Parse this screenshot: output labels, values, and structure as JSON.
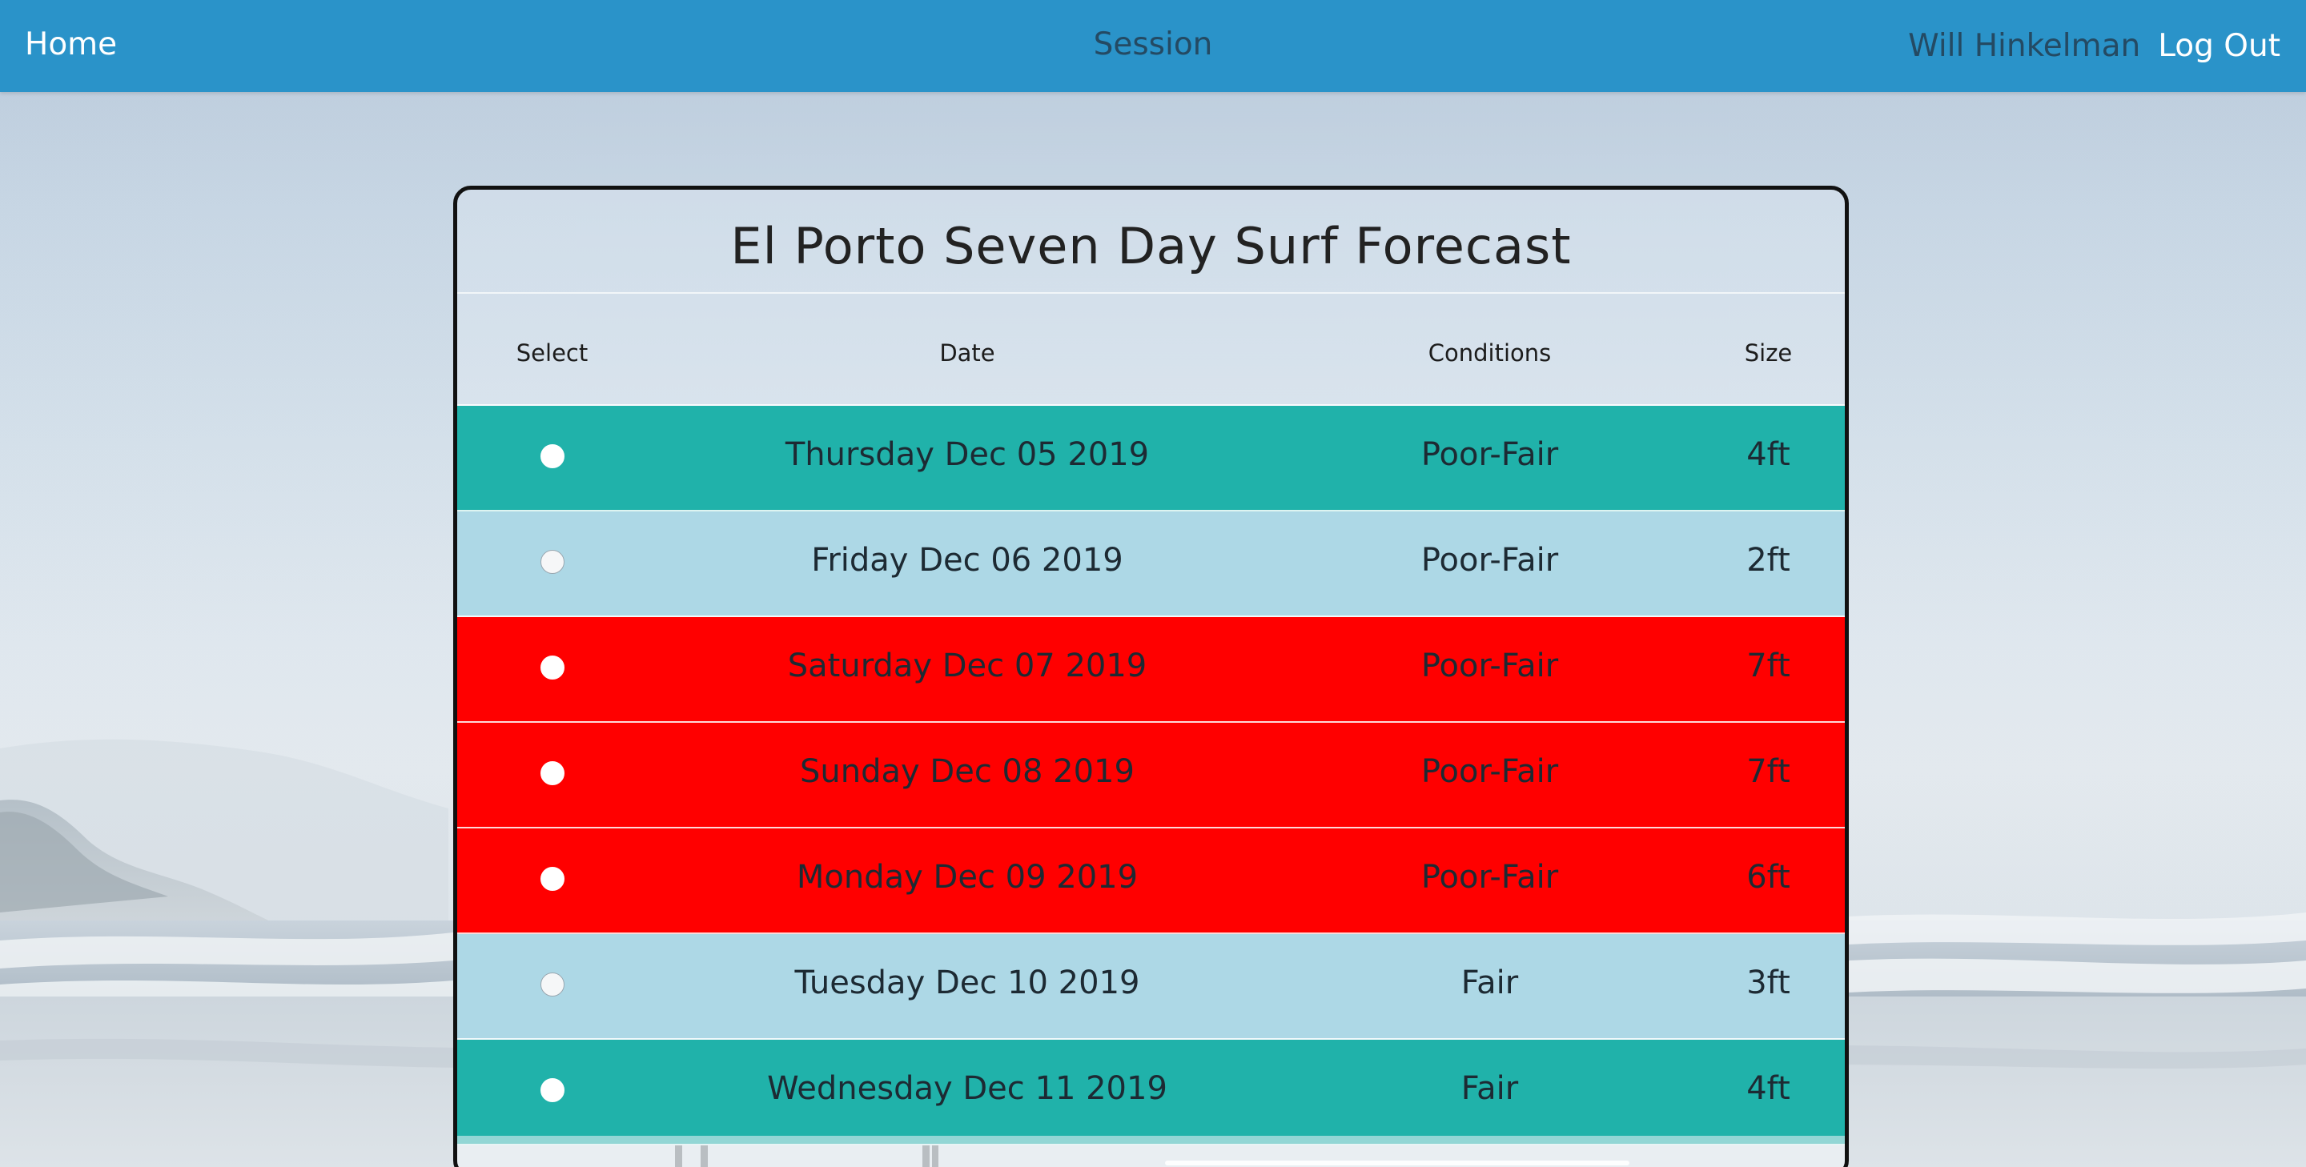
{
  "navbar": {
    "home_label": "Home",
    "title": "Session",
    "user_name": "Will Hinkelman",
    "logout_label": "Log Out"
  },
  "forecast": {
    "title": "El Porto Seven Day Surf Forecast",
    "columns": {
      "select": "Select",
      "date": "Date",
      "conditions": "Conditions",
      "size": "Size"
    },
    "rows": [
      {
        "date": "Thursday Dec 05 2019",
        "conditions": "Poor-Fair",
        "size": "4ft",
        "color": "#20b2aa"
      },
      {
        "date": "Friday Dec 06 2019",
        "conditions": "Poor-Fair",
        "size": "2ft",
        "color": "#add8e6"
      },
      {
        "date": "Saturday Dec 07 2019",
        "conditions": "Poor-Fair",
        "size": "7ft",
        "color": "#ff0000"
      },
      {
        "date": "Sunday Dec 08 2019",
        "conditions": "Poor-Fair",
        "size": "7ft",
        "color": "#ff0000"
      },
      {
        "date": "Monday Dec 09 2019",
        "conditions": "Poor-Fair",
        "size": "6ft",
        "color": "#ff0000"
      },
      {
        "date": "Tuesday Dec 10 2019",
        "conditions": "Fair",
        "size": "3ft",
        "color": "#add8e6"
      },
      {
        "date": "Wednesday Dec 11 2019",
        "conditions": "Fair",
        "size": "4ft",
        "color": "#20b2aa"
      }
    ]
  },
  "colors": {
    "navbar": "#2a93c9",
    "nav_text_dark": "#244a63",
    "nav_text_light": "#ffffff"
  }
}
